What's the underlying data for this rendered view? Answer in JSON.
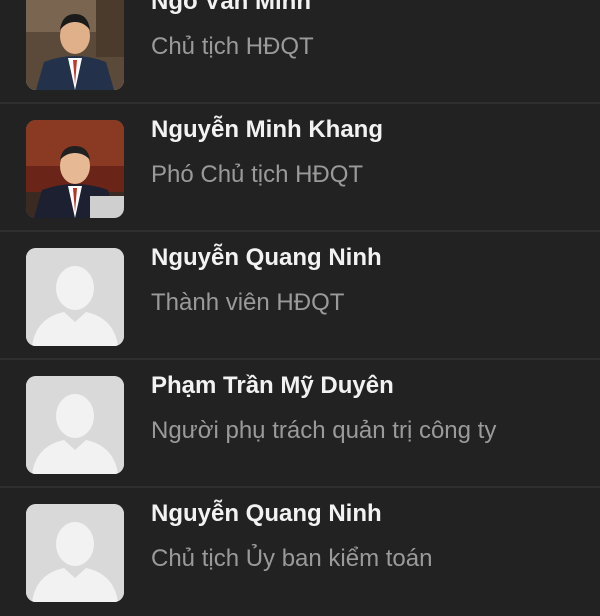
{
  "members": [
    {
      "name": "Ngô Văn Minh",
      "role": "Chủ tịch HĐQT",
      "avatar": "portrait-photo"
    },
    {
      "name": "Nguyễn Minh Khang",
      "role": "Phó Chủ tịch HĐQT",
      "avatar": "portrait-photo"
    },
    {
      "name": "Nguyễn Quang Ninh",
      "role": "Thành viên HĐQT",
      "avatar": "placeholder-silhouette"
    },
    {
      "name": "Phạm Trần Mỹ Duyên",
      "role": "Người phụ trách quản trị công ty",
      "avatar": "placeholder-silhouette"
    },
    {
      "name": "Nguyễn Quang Ninh",
      "role": "Chủ tịch Ủy ban kiểm toán",
      "avatar": "placeholder-silhouette"
    }
  ],
  "colors": {
    "background": "#222222",
    "divider": "#2f2f2f",
    "name_text": "#f2f2f2",
    "role_text": "#9a9a9a",
    "placeholder_bg": "#d9d9d9",
    "placeholder_figure": "#f2f2f2"
  }
}
